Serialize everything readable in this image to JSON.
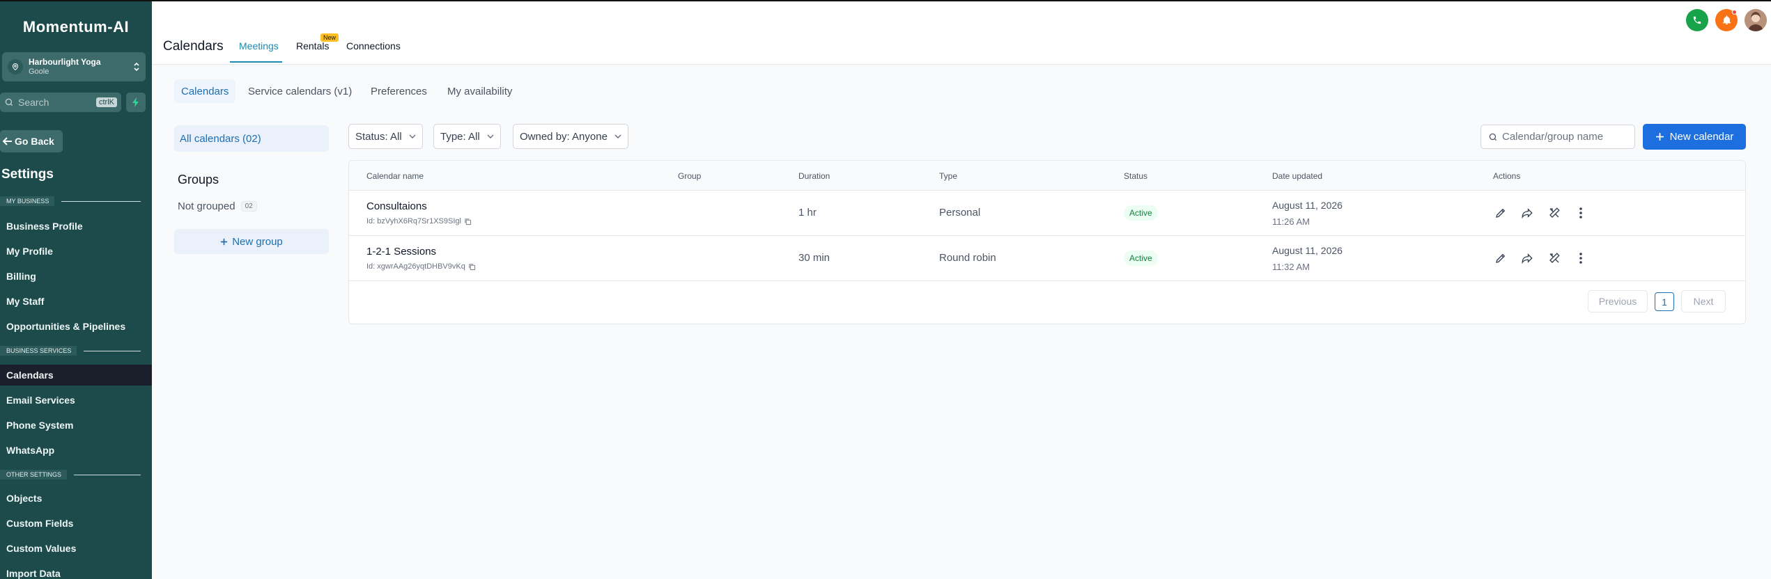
{
  "app": {
    "logo": "Momentum-AI"
  },
  "account": {
    "name": "Harbourlight Yoga",
    "location": "Goole"
  },
  "sidebar_search": {
    "placeholder": "Search",
    "shortcut": "ctrlK"
  },
  "go_back": "Go Back",
  "settings_title": "Settings",
  "sections": {
    "my_business": "MY BUSINESS",
    "business_services": "BUSINESS SERVICES",
    "other_settings": "OTHER SETTINGS"
  },
  "nav": {
    "business_profile": "Business Profile",
    "my_profile": "My Profile",
    "billing": "Billing",
    "my_staff": "My Staff",
    "opportunities": "Opportunities & Pipelines",
    "calendars": "Calendars",
    "email_services": "Email Services",
    "phone_system": "Phone System",
    "whatsapp": "WhatsApp",
    "objects": "Objects",
    "custom_fields": "Custom Fields",
    "custom_values": "Custom Values",
    "import_data": "Import Data"
  },
  "header": {
    "title": "Calendars",
    "tabs": {
      "meetings": "Meetings",
      "rentals": "Rentals",
      "connections": "Connections"
    },
    "new_badge": "New"
  },
  "sub_tabs": {
    "calendars": "Calendars",
    "service_calendars": "Service calendars (v1)",
    "preferences": "Preferences",
    "availability": "My availability"
  },
  "groups_panel": {
    "all_calendars": "All calendars (02)",
    "groups_title": "Groups",
    "not_grouped": "Not grouped",
    "not_grouped_count": "02",
    "new_group": "New group"
  },
  "filters": {
    "status": "Status: All",
    "type": "Type: All",
    "owned_by": "Owned by: Anyone"
  },
  "search": {
    "placeholder": "Calendar/group name"
  },
  "new_calendar": "New calendar",
  "table": {
    "headers": {
      "name": "Calendar name",
      "group": "Group",
      "duration": "Duration",
      "type": "Type",
      "status": "Status",
      "date_updated": "Date updated",
      "actions": "Actions"
    },
    "rows": [
      {
        "name": "Consultaions",
        "id": "Id: bzVyhX6Rq7Sr1XS9SIgl",
        "duration": "1 hr",
        "type": "Personal",
        "status": "Active",
        "date": "August 11, 2026",
        "time": "11:26 AM"
      },
      {
        "name": "1-2-1 Sessions",
        "id": "Id: xgwrAAg26yqtDHBV9vKq",
        "duration": "30 min",
        "type": "Round robin",
        "status": "Active",
        "date": "August 11, 2026",
        "time": "11:32 AM"
      }
    ]
  },
  "pagination": {
    "previous": "Previous",
    "page": "1",
    "next": "Next"
  },
  "colors": {
    "sidebar": "#1d4b4c",
    "accent": "#1d6fe0",
    "active_green": "#15803d"
  }
}
